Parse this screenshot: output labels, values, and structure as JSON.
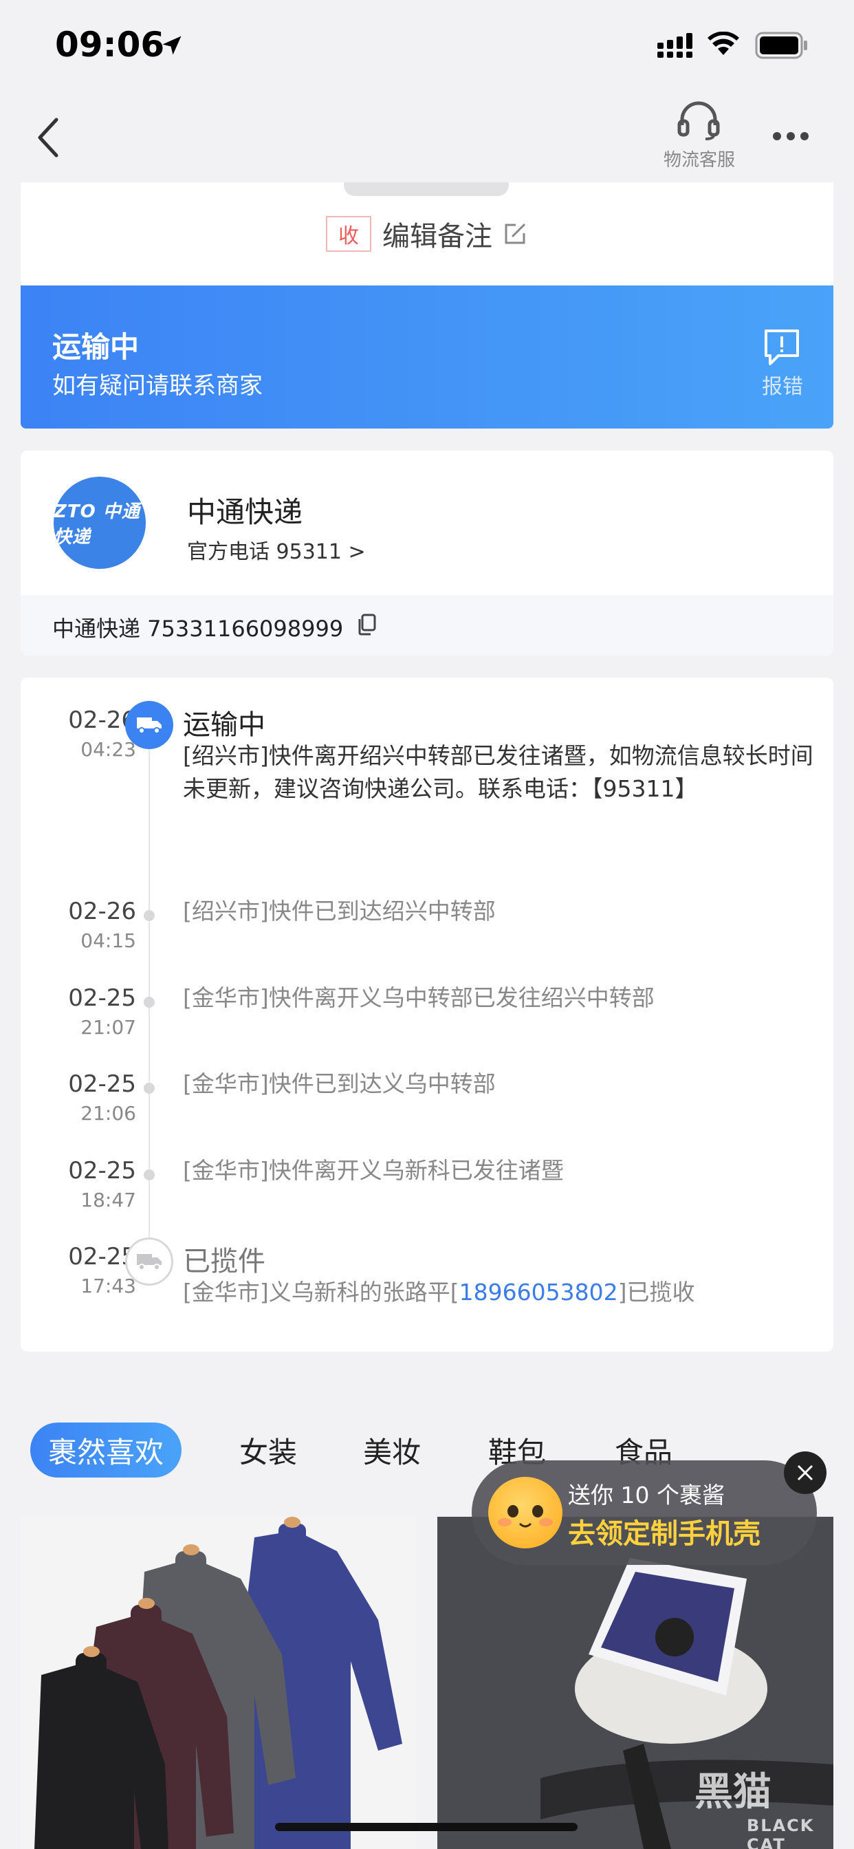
{
  "status_bar": {
    "time": "09:06",
    "icons": [
      "location-arrow-icon",
      "cellular-signal-icon",
      "wifi-icon",
      "battery-icon"
    ]
  },
  "nav": {
    "back_icon": "chevron-left-icon",
    "customer_service_label": "物流客服",
    "customer_service_icon": "headset-icon",
    "more_icon": "more-dots-icon"
  },
  "remark": {
    "badge": "收",
    "label": "编辑备注",
    "icon": "edit-icon"
  },
  "banner": {
    "title": "运输中",
    "subtitle": "如有疑问请联系商家",
    "report_label": "报错",
    "report_icon": "report-message-icon",
    "colors": {
      "start": "#3c83f5",
      "end": "#4aa3f8"
    }
  },
  "courier": {
    "logo_text": "ZTO 中通快递",
    "name": "中通快递",
    "phone_label": "官方电话 95311 >",
    "tracking": "中通快递 75331166098999",
    "copy_icon": "copy-icon"
  },
  "timeline": [
    {
      "date": "02-26",
      "time": "04:23",
      "status": "运输中",
      "description": "[绍兴市]快件离开绍兴中转部已发往诸暨，如物流信息较长时间未更新，建议咨询快递公司。联系电话：【95311】",
      "icon": "truck-icon"
    },
    {
      "date": "02-26",
      "time": "04:15",
      "description": "[绍兴市]快件已到达绍兴中转部"
    },
    {
      "date": "02-25",
      "time": "21:07",
      "description": "[金华市]快件离开义乌中转部已发往绍兴中转部"
    },
    {
      "date": "02-25",
      "time": "21:06",
      "description": "[金华市]快件已到达义乌中转部"
    },
    {
      "date": "02-25",
      "time": "18:47",
      "description": "[金华市]快件离开义乌新科已发往诸暨"
    },
    {
      "date": "02-25",
      "time": "17:43",
      "status": "已揽件",
      "description_prefix": "[金华市]义乌新科的张路平[",
      "phone": "18966053802",
      "description_suffix": "]已揽收",
      "icon": "pickup-truck-icon"
    }
  ],
  "tabs": [
    {
      "label": "裹然喜欢",
      "active": true
    },
    {
      "label": "女装",
      "active": false
    },
    {
      "label": "美妆",
      "active": false
    },
    {
      "label": "鞋包",
      "active": false
    },
    {
      "label": "食品",
      "active": false
    }
  ],
  "products": [
    {
      "icon": "turtleneck-shirts-image"
    },
    {
      "icon": "phone-stand-image"
    }
  ],
  "promo": {
    "line1": "送你 10 个裹酱",
    "line2": "去领定制手机壳",
    "icon": "smiley-face-icon",
    "close_icon": "close-icon"
  },
  "watermark": {
    "text": "黑猫",
    "sub": "BLACK CAT"
  }
}
